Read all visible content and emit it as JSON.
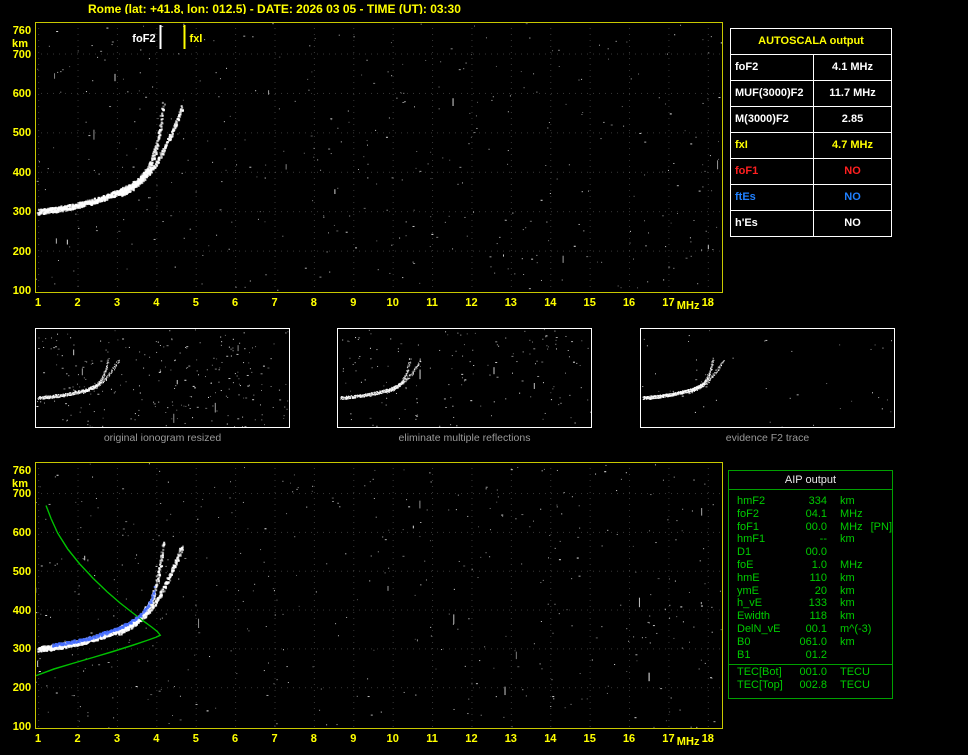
{
  "window": {
    "title": "Rome (lat: +41.8, lon: 012.5) - DATE: 2026 03 05 - TIME (UT): 03:30"
  },
  "colors": {
    "background": "#000000",
    "axis_labels": "#ffff00",
    "plot_border": "#c8c800",
    "trace": "#ffffff",
    "profile_green": "#00c000",
    "fitted_blue": "#4466ff",
    "table_grid": "#ffffff",
    "aip_border": "#00a000",
    "aip_text": "#00cc00",
    "caption_gray": "#9a9a9a"
  },
  "autoscala": {
    "title": "AUTOSCALA output",
    "rows": [
      {
        "param": "foF2",
        "value": "4.1 MHz",
        "color": "#ffffff"
      },
      {
        "param": "MUF(3000)F2",
        "value": "11.7 MHz",
        "color": "#ffffff"
      },
      {
        "param": "M(3000)F2",
        "value": "2.85",
        "color": "#ffffff"
      },
      {
        "param": "fxI",
        "value": "4.7 MHz",
        "color": "#ffff00"
      },
      {
        "param": "foF1",
        "value": "NO",
        "color": "#ff2020"
      },
      {
        "param": "ftEs",
        "value": "NO",
        "color": "#2080ff"
      },
      {
        "param": "h'Es",
        "value": "NO",
        "color": "#ffffff"
      }
    ]
  },
  "thumbnails": [
    {
      "caption": "original ionogram resized"
    },
    {
      "caption": "eliminate multiple reflections"
    },
    {
      "caption": "evidence F2 trace"
    }
  ],
  "aip": {
    "title": "AIP output",
    "rows": [
      {
        "param": "hmF2",
        "value": "334",
        "unit": "km",
        "extra": ""
      },
      {
        "param": "foF2",
        "value": "04.1",
        "unit": "MHz",
        "extra": ""
      },
      {
        "param": "foF1",
        "value": "00.0",
        "unit": "MHz",
        "extra": "[PN]"
      },
      {
        "param": "hmF1",
        "value": "--",
        "unit": "km",
        "extra": ""
      },
      {
        "param": "D1",
        "value": "00.0",
        "unit": "",
        "extra": ""
      },
      {
        "param": "foE",
        "value": "1.0",
        "unit": "MHz",
        "extra": ""
      },
      {
        "param": "hmE",
        "value": "110",
        "unit": "km",
        "extra": ""
      },
      {
        "param": "ymE",
        "value": "20",
        "unit": "km",
        "extra": ""
      },
      {
        "param": "h_vE",
        "value": "133",
        "unit": "km",
        "extra": ""
      },
      {
        "param": "Ewidth",
        "value": "118",
        "unit": "km",
        "extra": ""
      },
      {
        "param": "DelN_vE",
        "value": "00.1",
        "unit": "m^(-3)",
        "extra": ""
      },
      {
        "param": "B0",
        "value": "061.0",
        "unit": "km",
        "extra": ""
      },
      {
        "param": "B1",
        "value": "01.2",
        "unit": "",
        "extra": ""
      }
    ],
    "tec_rows": [
      {
        "param": "TEC[Bot]",
        "value": "001.0",
        "unit": "TECU"
      },
      {
        "param": "TEC[Top]",
        "value": "002.8",
        "unit": "TECU"
      }
    ]
  },
  "chart_data": [
    {
      "name": "main_ionogram",
      "type": "scatter",
      "xlabel": "MHz",
      "ylabel": "km",
      "xlim": [
        1,
        18
      ],
      "ylim": [
        100,
        760
      ],
      "x_ticks": [
        1,
        2,
        3,
        4,
        5,
        6,
        7,
        8,
        9,
        10,
        11,
        12,
        13,
        14,
        15,
        16,
        17,
        18
      ],
      "y_ticks": [
        100,
        200,
        300,
        400,
        500,
        600,
        700,
        760
      ],
      "o_trace": [
        [
          1.0,
          300
        ],
        [
          1.4,
          305
        ],
        [
          1.8,
          312
        ],
        [
          2.2,
          321
        ],
        [
          2.6,
          333
        ],
        [
          3.0,
          348
        ],
        [
          3.3,
          362
        ],
        [
          3.6,
          384
        ],
        [
          3.8,
          410
        ],
        [
          3.92,
          440
        ],
        [
          4.0,
          472
        ],
        [
          4.08,
          512
        ],
        [
          4.14,
          552
        ],
        [
          4.17,
          575
        ]
      ],
      "x_trace": [
        [
          3.05,
          342
        ],
        [
          3.4,
          362
        ],
        [
          3.7,
          388
        ],
        [
          3.95,
          418
        ],
        [
          4.15,
          452
        ],
        [
          4.35,
          492
        ],
        [
          4.52,
          532
        ],
        [
          4.65,
          565
        ]
      ],
      "markers": [
        {
          "label": "foF2",
          "mhz": 4.1,
          "color": "#ffffff",
          "align": "right"
        },
        {
          "label": "fxI",
          "mhz": 4.7,
          "color": "#ffff00",
          "align": "left"
        }
      ],
      "scaled_values": {
        "foF2_MHz": 4.1,
        "MUF3000F2_MHz": 11.7,
        "M3000F2": 2.85,
        "fxI_MHz": 4.7,
        "foF1": "NO",
        "ftEs": "NO",
        "hEs": "NO"
      }
    },
    {
      "name": "aip_ionogram",
      "type": "scatter",
      "xlabel": "MHz",
      "ylabel": "km",
      "xlim": [
        1,
        18
      ],
      "ylim": [
        100,
        760
      ],
      "profile_green": [
        [
          0.95,
          230
        ],
        [
          1.4,
          247
        ],
        [
          1.9,
          262
        ],
        [
          2.4,
          277
        ],
        [
          2.9,
          292
        ],
        [
          3.4,
          308
        ],
        [
          3.75,
          320
        ],
        [
          4.0,
          329
        ],
        [
          4.1,
          334
        ],
        [
          4.03,
          343
        ],
        [
          3.88,
          355
        ],
        [
          3.65,
          372
        ],
        [
          3.38,
          393
        ],
        [
          3.08,
          417
        ],
        [
          2.75,
          446
        ],
        [
          2.4,
          480
        ],
        [
          2.05,
          518
        ],
        [
          1.75,
          556
        ],
        [
          1.5,
          596
        ],
        [
          1.33,
          634
        ],
        [
          1.2,
          668
        ]
      ],
      "fitted_blue_range_mhz": [
        1.35,
        3.95
      ],
      "hmF2_km": 334,
      "foF2_MHz": 4.1
    }
  ]
}
